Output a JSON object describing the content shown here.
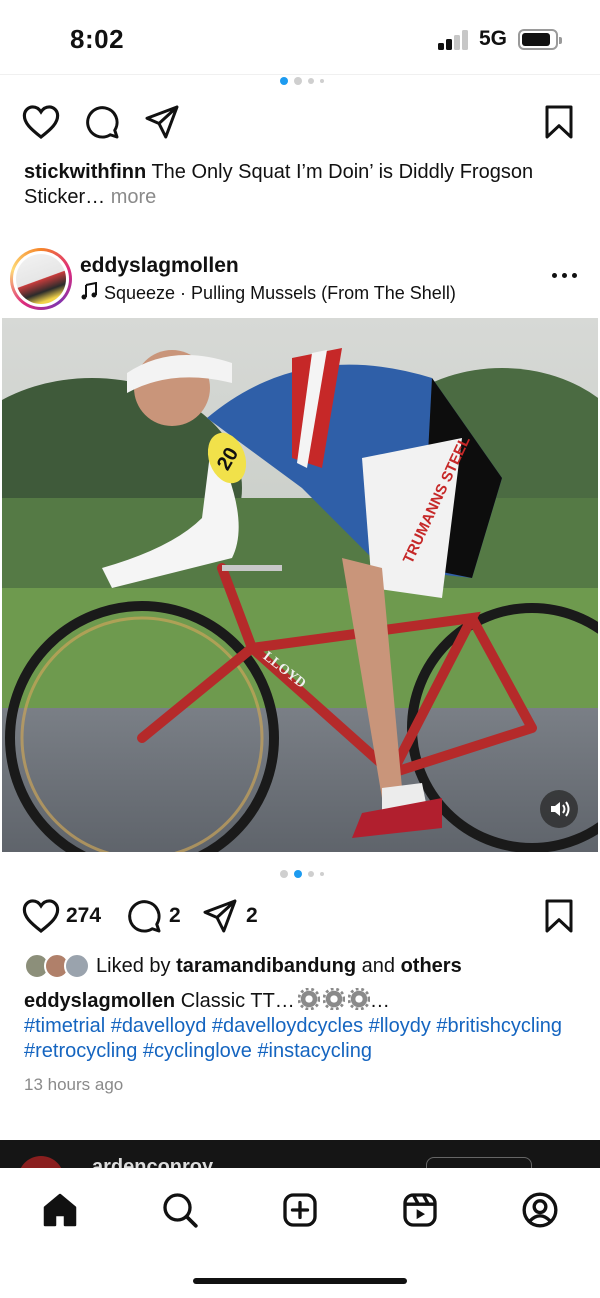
{
  "status_bar": {
    "time": "8:02",
    "network": "5G",
    "battery_level": 0.8
  },
  "previous_post": {
    "carousel_dots": 4,
    "carousel_active_index": 0,
    "caption_username": "stickwithfinn",
    "caption_text": "The Only Squat I’m Doin’ is Diddly Frogson Sticker…",
    "more_label": "more"
  },
  "post": {
    "username": "eddyslagmollen",
    "music": "Squeeze · Pulling Mussels (From The Shell)",
    "carousel_dots": 4,
    "carousel_active_index": 1,
    "like_count": "274",
    "comment_count": "2",
    "share_count": "2",
    "liked_by_prefix": "Liked by",
    "liked_by_user": "taramandibandung",
    "liked_by_and": "and",
    "liked_by_others": "others",
    "caption_username": "eddyslagmollen",
    "caption_text": "Classic TT…",
    "caption_suffix": "…",
    "hashtags": "#timetrial #davelloyd #davelloydcycles #lloydy #britishcycling #retrocycling #cyclinglove #instacycling",
    "time_ago": "13 hours ago",
    "photo_jersey_text": "TRUMANNS STEEL",
    "photo_frame_text": "LLOYD",
    "photo_number": "20"
  },
  "next_post": {
    "username": "ardenconroy"
  },
  "colors": {
    "link": "#1565c0",
    "accent_dot": "#1d9bf0",
    "muted": "#8a8a8a"
  },
  "icons": {
    "tabs": [
      "home-icon",
      "search-icon",
      "create-icon",
      "reels-icon",
      "profile-icon"
    ]
  }
}
